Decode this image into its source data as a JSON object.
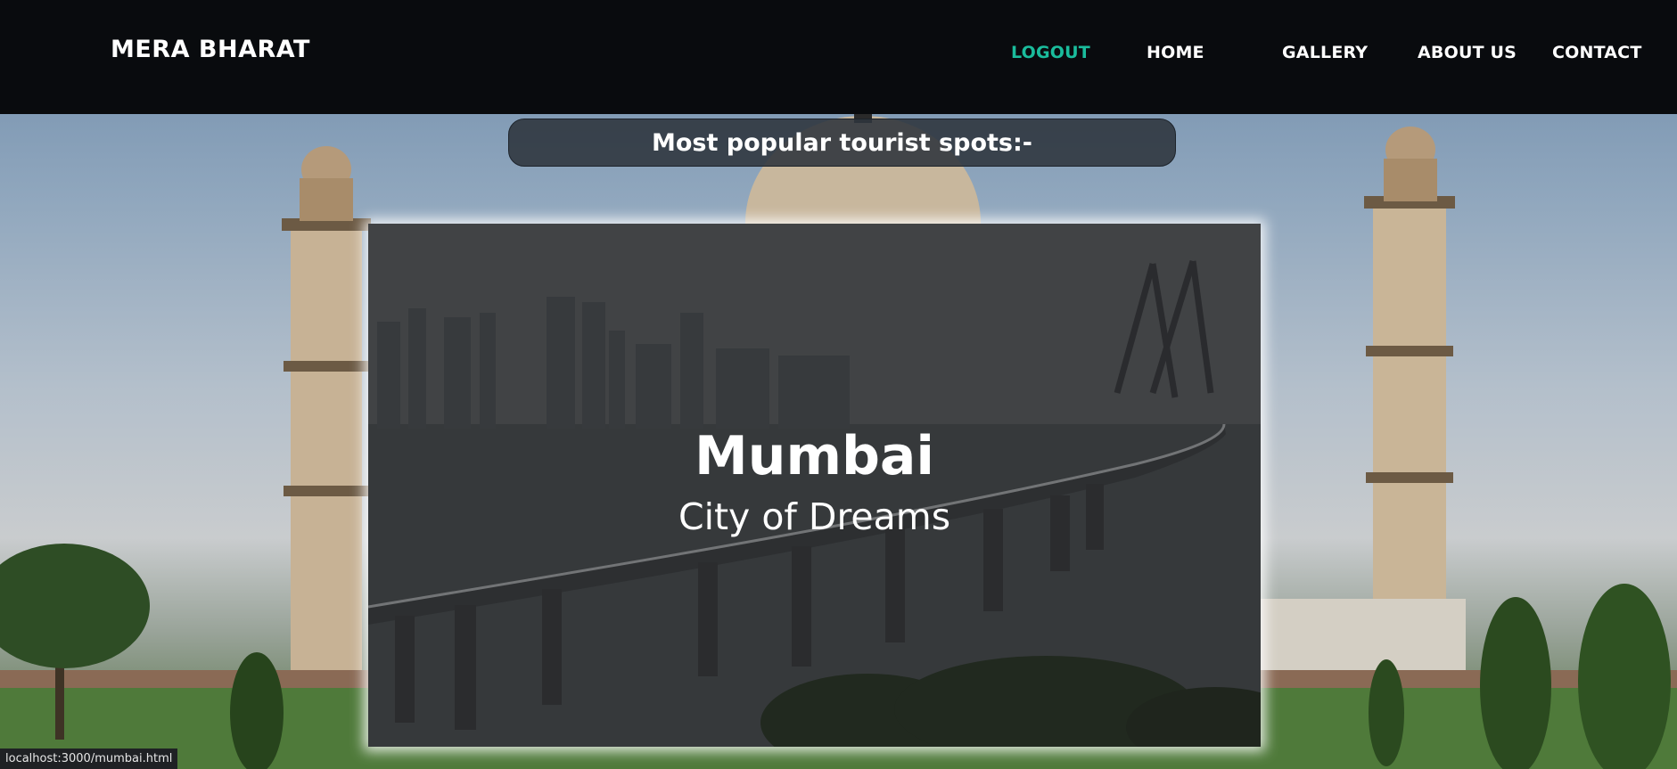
{
  "brand": "MERA BHARAT",
  "nav": {
    "logout": "LOGOUT",
    "home": "HOME",
    "gallery": "GALLERY",
    "about": "ABOUT US",
    "contact": "CONTACT"
  },
  "section": {
    "heading": "Most popular tourist spots:-"
  },
  "card": {
    "title": "Mumbai",
    "subtitle": "City of Dreams"
  },
  "statusbar": {
    "url": "localhost:3000/mumbai.html"
  },
  "colors": {
    "navbar": "#090b0e",
    "accent": "#1abc9c",
    "text": "#ffffff"
  }
}
